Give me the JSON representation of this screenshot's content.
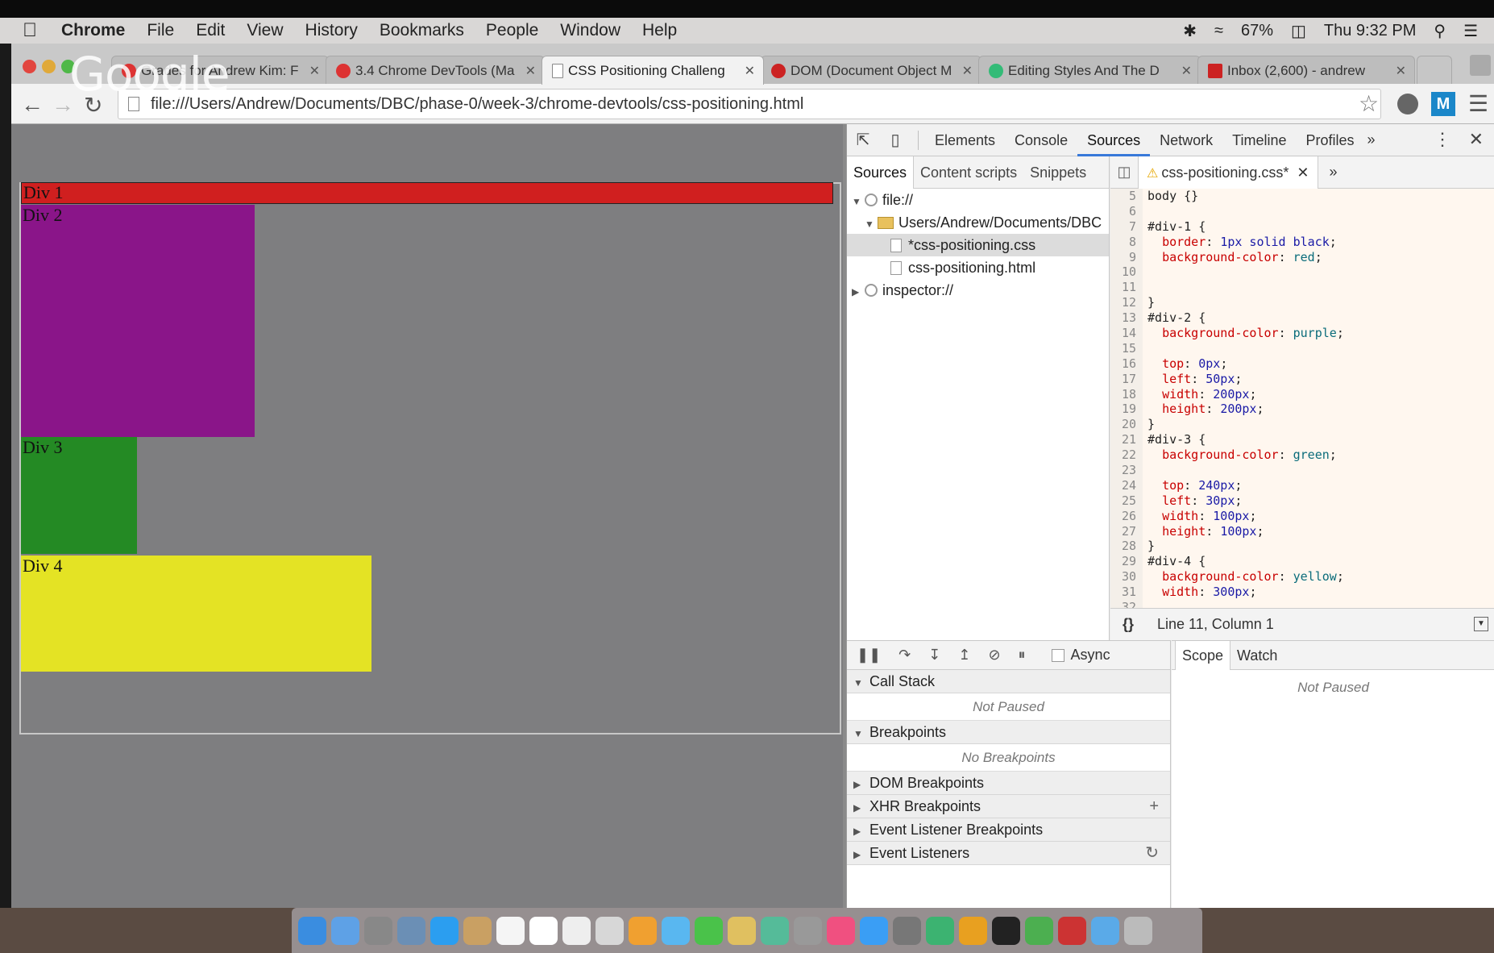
{
  "menubar": {
    "app": "Chrome",
    "items": [
      "File",
      "Edit",
      "View",
      "History",
      "Bookmarks",
      "People",
      "Window",
      "Help"
    ],
    "battery": "67%",
    "clock": "Thu 9:32 PM"
  },
  "overlay_logo": "Google",
  "tabs": [
    {
      "label": "Grades for Andrew Kim: F",
      "icon_color": "#d33"
    },
    {
      "label": "3.4 Chrome DevTools (Ma",
      "icon_color": "#d33"
    },
    {
      "label": "CSS Positioning Challeng",
      "icon_color": "#fff",
      "active": true
    },
    {
      "label": "DOM (Document Object M",
      "icon_color": "#c22"
    },
    {
      "label": "Editing Styles And The D",
      "icon_color": "#3b7"
    },
    {
      "label": "Inbox (2,600) - andrew",
      "icon_color": "#c22"
    }
  ],
  "address": "file:///Users/Andrew/Documents/DBC/phase-0/week-3/chrome-devtools/css-positioning.html",
  "extension_label": "M",
  "page": {
    "div1": "Div 1",
    "div2": "Div 2",
    "div3": "Div 3",
    "div4": "Div 4"
  },
  "devtools": {
    "tabs": [
      "Elements",
      "Console",
      "Sources",
      "Network",
      "Timeline",
      "Profiles"
    ],
    "active_tab": "Sources",
    "nav_tabs": [
      "Sources",
      "Content scripts",
      "Snippets"
    ],
    "tree": [
      {
        "label": "file://",
        "kind": "globe",
        "indent": 0,
        "open": true
      },
      {
        "label": "Users/Andrew/Documents/DBC",
        "kind": "folder",
        "indent": 1,
        "open": true
      },
      {
        "label": "*css-positioning.css",
        "kind": "file",
        "indent": 2,
        "selected": true
      },
      {
        "label": "css-positioning.html",
        "kind": "file",
        "indent": 2
      },
      {
        "label": "inspector://",
        "kind": "globe",
        "indent": 0,
        "open": false
      }
    ],
    "editor_tab": "css-positioning.css*",
    "code": [
      {
        "n": "5",
        "t": "body {}"
      },
      {
        "n": "6",
        "t": ""
      },
      {
        "n": "7",
        "t": "#div-1 {"
      },
      {
        "n": "8",
        "t": "  border: 1px solid black;"
      },
      {
        "n": "9",
        "t": "  background-color: red;"
      },
      {
        "n": "10",
        "t": ""
      },
      {
        "n": "11",
        "t": ""
      },
      {
        "n": "12",
        "t": "}"
      },
      {
        "n": "13",
        "t": "#div-2 {"
      },
      {
        "n": "14",
        "t": "  background-color: purple;"
      },
      {
        "n": "15",
        "t": ""
      },
      {
        "n": "16",
        "t": "  top: 0px;"
      },
      {
        "n": "17",
        "t": "  left: 50px;"
      },
      {
        "n": "18",
        "t": "  width: 200px;"
      },
      {
        "n": "19",
        "t": "  height: 200px;"
      },
      {
        "n": "20",
        "t": "}"
      },
      {
        "n": "21",
        "t": "#div-3 {"
      },
      {
        "n": "22",
        "t": "  background-color: green;"
      },
      {
        "n": "23",
        "t": ""
      },
      {
        "n": "24",
        "t": "  top: 240px;"
      },
      {
        "n": "25",
        "t": "  left: 30px;"
      },
      {
        "n": "26",
        "t": "  width: 100px;"
      },
      {
        "n": "27",
        "t": "  height: 100px;"
      },
      {
        "n": "28",
        "t": "}"
      },
      {
        "n": "29",
        "t": "#div-4 {"
      },
      {
        "n": "30",
        "t": "  background-color: yellow;"
      },
      {
        "n": "31",
        "t": "  width: 300px;"
      },
      {
        "n": "32",
        "t": ""
      }
    ],
    "status": "Line 11, Column 1",
    "status_braces": "{}",
    "async_label": "Async",
    "sections": {
      "call_stack": "Call Stack",
      "not_paused": "Not Paused",
      "breakpoints": "Breakpoints",
      "no_breakpoints": "No Breakpoints",
      "dom_breakpoints": "DOM Breakpoints",
      "xhr_breakpoints": "XHR Breakpoints",
      "event_listener_breakpoints": "Event Listener Breakpoints",
      "event_listeners": "Event Listeners"
    },
    "scope_tabs": [
      "Scope",
      "Watch"
    ],
    "scope_empty": "Not Paused"
  },
  "dock_colors": [
    "#3a8de0",
    "#5ea1e6",
    "#888",
    "#6b8fb5",
    "#2b9ef0",
    "#c9a063",
    "#f5f5f5",
    "#fff",
    "#eee",
    "#d7d7d7",
    "#f0a030",
    "#59b7f0",
    "#4ac24a",
    "#e0c060",
    "#5b9",
    "#999",
    "#f05080",
    "#3a9ef5",
    "#777",
    "#3cb371",
    "#e8a020",
    "#222",
    "#4caf50",
    "#c33",
    "#5aaae8",
    "#bbb"
  ]
}
